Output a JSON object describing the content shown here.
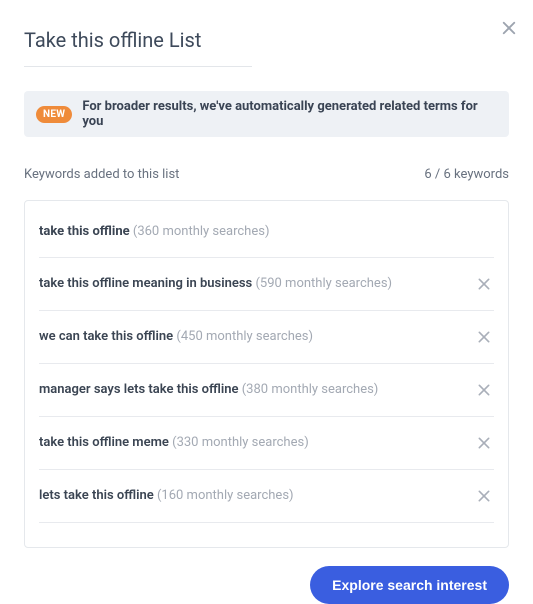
{
  "title": "Take this offline List",
  "banner": {
    "badge": "NEW",
    "text": "For broader results, we've automatically generated related terms for you"
  },
  "list_header": {
    "label": "Keywords added to this list",
    "count": "6 / 6 keywords"
  },
  "keywords": [
    {
      "term": "take this offline",
      "meta": "(360 monthly searches)",
      "removable": false
    },
    {
      "term": "take this offline meaning in business",
      "meta": "(590 monthly searches)",
      "removable": true
    },
    {
      "term": "we can take this offline",
      "meta": "(450 monthly searches)",
      "removable": true
    },
    {
      "term": "manager says lets take this offline",
      "meta": "(380 monthly searches)",
      "removable": true
    },
    {
      "term": "take this offline meme",
      "meta": "(330 monthly searches)",
      "removable": true
    },
    {
      "term": "lets take this offline",
      "meta": "(160 monthly searches)",
      "removable": true
    }
  ],
  "footer": {
    "explore_label": "Explore search interest"
  }
}
